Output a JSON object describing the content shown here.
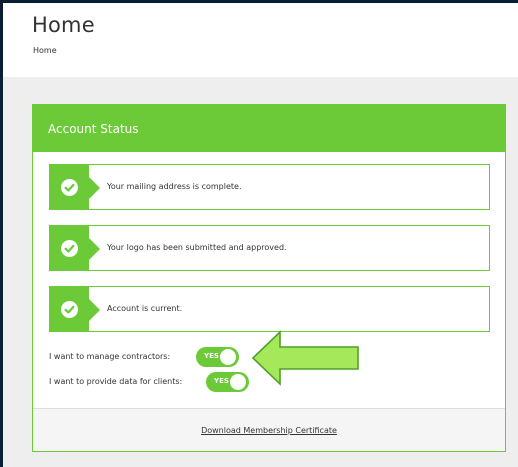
{
  "header": {
    "title": "Home",
    "breadcrumb": "Home"
  },
  "account_status": {
    "title": "Account Status",
    "items": [
      {
        "label": "Your mailing address is complete.",
        "icon": "check-icon"
      },
      {
        "label": "Your logo has been submitted and approved.",
        "icon": "check-icon"
      },
      {
        "label": "Account is current.",
        "icon": "check-icon"
      }
    ],
    "toggles": [
      {
        "label": "I want to manage contractors:",
        "value": "YES"
      },
      {
        "label": "I want to provide data for clients:",
        "value": "YES"
      }
    ],
    "download_link": "Download Membership Certificate"
  },
  "colors": {
    "accent_green": "#6cc938",
    "arrow_green": "#a5e85a",
    "frame_border": "#0b1e33"
  }
}
